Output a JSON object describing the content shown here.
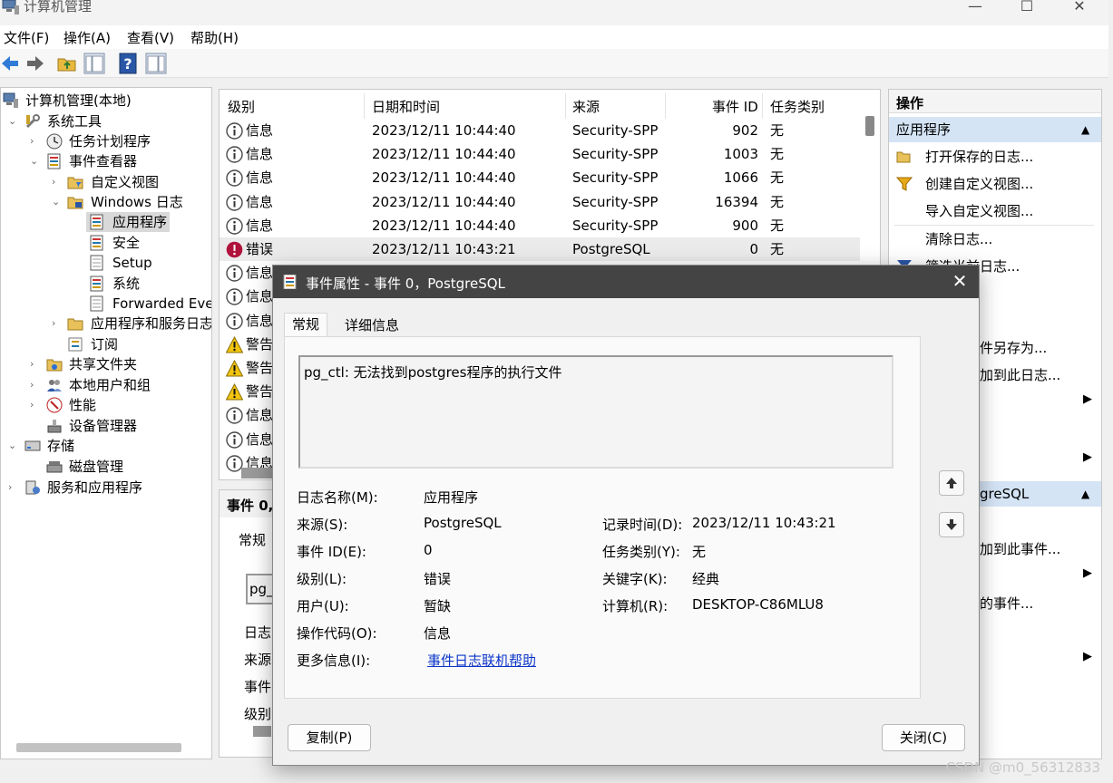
{
  "window": {
    "title": "计算机管理",
    "minimize": "—",
    "maximize": "☐",
    "close": "✕"
  },
  "menu": [
    "文件(F)",
    "操作(A)",
    "查看(V)",
    "帮助(H)"
  ],
  "tree": {
    "root": "计算机管理(本地)",
    "system_tools": "系统工具",
    "task_scheduler": "任务计划程序",
    "event_viewer": "事件查看器",
    "custom_views": "自定义视图",
    "windows_logs": "Windows 日志",
    "application": "应用程序",
    "security": "安全",
    "setup": "Setup",
    "system": "系统",
    "forwarded": "Forwarded Even",
    "apps_services_logs": "应用程序和服务日志",
    "subscriptions": "订阅",
    "shared_folders": "共享文件夹",
    "local_users": "本地用户和组",
    "performance": "性能",
    "device_manager": "设备管理器",
    "storage": "存储",
    "disk_management": "磁盘管理",
    "services_apps": "服务和应用程序"
  },
  "events": {
    "columns": {
      "level": "级别",
      "datetime": "日期和时间",
      "source": "来源",
      "event_id": "事件 ID",
      "task": "任务类别"
    },
    "rows": [
      {
        "level": "信息",
        "type": "info",
        "datetime": "2023/12/11 10:44:40",
        "source": "Security-SPP",
        "event_id": "902",
        "task": "无"
      },
      {
        "level": "信息",
        "type": "info",
        "datetime": "2023/12/11 10:44:40",
        "source": "Security-SPP",
        "event_id": "1003",
        "task": "无"
      },
      {
        "level": "信息",
        "type": "info",
        "datetime": "2023/12/11 10:44:40",
        "source": "Security-SPP",
        "event_id": "1066",
        "task": "无"
      },
      {
        "level": "信息",
        "type": "info",
        "datetime": "2023/12/11 10:44:40",
        "source": "Security-SPP",
        "event_id": "16394",
        "task": "无"
      },
      {
        "level": "信息",
        "type": "info",
        "datetime": "2023/12/11 10:44:40",
        "source": "Security-SPP",
        "event_id": "900",
        "task": "无"
      },
      {
        "level": "错误",
        "type": "error",
        "datetime": "2023/12/11 10:43:21",
        "source": "PostgreSQL",
        "event_id": "0",
        "task": "无"
      },
      {
        "level": "信息",
        "type": "info",
        "datetime": "",
        "source": "",
        "event_id": "",
        "task": ""
      },
      {
        "level": "信息",
        "type": "info",
        "datetime": "",
        "source": "",
        "event_id": "",
        "task": ""
      },
      {
        "level": "信息",
        "type": "info",
        "datetime": "",
        "source": "",
        "event_id": "",
        "task": ""
      },
      {
        "level": "警告",
        "type": "warning",
        "datetime": "",
        "source": "",
        "event_id": "",
        "task": ""
      },
      {
        "level": "警告",
        "type": "warning",
        "datetime": "",
        "source": "",
        "event_id": "",
        "task": ""
      },
      {
        "level": "警告",
        "type": "warning",
        "datetime": "",
        "source": "",
        "event_id": "",
        "task": ""
      },
      {
        "level": "信息",
        "type": "info",
        "datetime": "",
        "source": "",
        "event_id": "",
        "task": ""
      },
      {
        "level": "信息",
        "type": "info",
        "datetime": "",
        "source": "",
        "event_id": "",
        "task": ""
      },
      {
        "level": "信息",
        "type": "info",
        "datetime": "",
        "source": "",
        "event_id": "",
        "task": ""
      }
    ]
  },
  "detail_preview": {
    "title": "事件 0,",
    "tab": "常规",
    "desc": "pg_",
    "f1": "日志",
    "f2": "来源",
    "f3": "事件",
    "f4": "级别"
  },
  "actions": {
    "header": "操作",
    "section1": "应用程序",
    "items1": [
      "打开保存的日志...",
      "创建自定义视图...",
      "导入自定义视图...",
      "清除日志...",
      "筛选当前日志..."
    ],
    "partial1": "件另存为...",
    "partial2": "加到此日志...",
    "section2_partial": "greSQL",
    "partial3": "加到此事件...",
    "partial4": "的事件..."
  },
  "dialog": {
    "title": "事件属性 - 事件 0，PostgreSQL",
    "tab_general": "常规",
    "tab_details": "详细信息",
    "description": "pg_ctl: 无法找到postgres程序的执行文件",
    "fields": {
      "log_name_label": "日志名称(M):",
      "log_name": "应用程序",
      "source_label": "来源(S):",
      "source": "PostgreSQL",
      "logged_label": "记录时间(D):",
      "logged": "2023/12/11 10:43:21",
      "event_id_label": "事件 ID(E):",
      "event_id": "0",
      "task_label": "任务类别(Y):",
      "task": "无",
      "level_label": "级别(L):",
      "level": "错误",
      "keywords_label": "关键字(K):",
      "keywords": "经典",
      "user_label": "用户(U):",
      "user": "暂缺",
      "computer_label": "计算机(R):",
      "computer": "DESKTOP-C86MLU8",
      "opcode_label": "操作代码(O):",
      "opcode": "信息",
      "more_info_label": "更多信息(I):",
      "more_info_link": "事件日志联机帮助"
    },
    "copy_button": "复制(P)",
    "close_button": "关闭(C)"
  },
  "watermark": "CSDN @m0_56312833",
  "colors": {
    "dialog_title_bg": "#444444",
    "action_header_bg": "#d4e4f5",
    "link": "#0b35c8",
    "error_icon": "#b0123c",
    "warning_icon": "#f1c40f",
    "info_icon": "#2b579a"
  }
}
